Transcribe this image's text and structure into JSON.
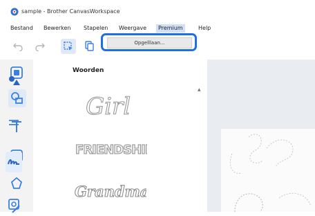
{
  "window": {
    "title": "sample - Brother CanvasWorkspace"
  },
  "menu": {
    "items": [
      {
        "label": "Bestand"
      },
      {
        "label": "Bewerken"
      },
      {
        "label": "Stapelen"
      },
      {
        "label": "Weergave"
      },
      {
        "label": "Premium"
      },
      {
        "label": "Help"
      }
    ],
    "active_index": 4
  },
  "dropdown": {
    "item_label": "Opgelllaan..."
  },
  "panel": {
    "title": "Woorden",
    "words": [
      "Girl",
      "FRIENDSHIP",
      "Grandma"
    ]
  },
  "icons": {
    "app_logo": "app-logo-icon",
    "undo": "undo-icon",
    "redo": "redo-icon",
    "select": "select-icon",
    "copy": "copy-icon"
  },
  "colors": {
    "highlight": "#1f6fe0",
    "accent_blue": "#3b7fe0",
    "canvas_bg": "#e9ecf1",
    "selected_cat": "#e2edfb"
  }
}
